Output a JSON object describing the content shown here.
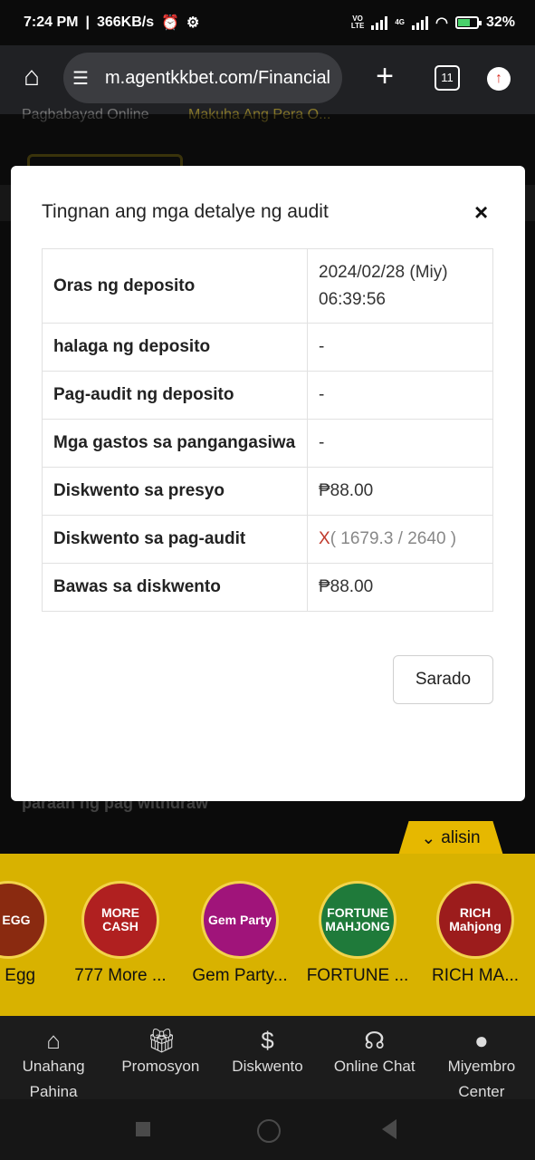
{
  "status_bar": {
    "time": "7:24 PM",
    "speed": "366KB/s",
    "network_top": "VO",
    "network_bottom": "LTE",
    "network_4g": "4G",
    "battery": "32%"
  },
  "browser": {
    "url": "m.agentkkbet.com/Financial",
    "tab_count": "11"
  },
  "background_page": {
    "tab_left": "Pagbabayad Online",
    "tab_right": "Makuha Ang Pera O...",
    "withdraw_text": "paraan ng pag withdraw"
  },
  "modal": {
    "title": "Tingnan ang mga detalye ng audit",
    "close_symbol": "×",
    "rows": [
      {
        "label": "Oras ng deposito",
        "value": "2024/02/28 (Miy) 06:39:56"
      },
      {
        "label": "halaga ng deposito",
        "value": "-"
      },
      {
        "label": "Pag-audit ng deposito",
        "value": "-"
      },
      {
        "label": "Mga gastos sa pangangasiwa",
        "value": "-"
      },
      {
        "label": "Diskwento sa presyo",
        "value": "₱88.00"
      },
      {
        "label": "Diskwento sa pag-audit",
        "value_mark": "X",
        "value": "( 1679.3 / 2640 )"
      },
      {
        "label": "Bawas sa diskwento",
        "value": "₱88.00"
      }
    ],
    "close_button": "Sarado"
  },
  "alisin_label": "alisin",
  "games": [
    {
      "name": "on Egg",
      "icon_text": "IN EGG"
    },
    {
      "name": "777 More ...",
      "icon_text": "MORE CASH"
    },
    {
      "name": "Gem Party...",
      "icon_text": "Gem Party"
    },
    {
      "name": "FORTUNE ...",
      "icon_text": "FORTUNE MAHJONG"
    },
    {
      "name": "RICH MA...",
      "icon_text": "RICH Mahjong"
    }
  ],
  "bottom_nav": [
    {
      "label": "Unahang Pahina",
      "icon": "home-icon"
    },
    {
      "label": "Promosyon",
      "icon": "gift-icon"
    },
    {
      "label": "Diskwento",
      "icon": "dollar-icon"
    },
    {
      "label": "Online Chat",
      "icon": "headset-icon"
    },
    {
      "label": "Miyembro Center",
      "icon": "user-icon"
    }
  ],
  "colors": {
    "accent_yellow": "#d8b200",
    "negative_red": "#c0392b"
  }
}
